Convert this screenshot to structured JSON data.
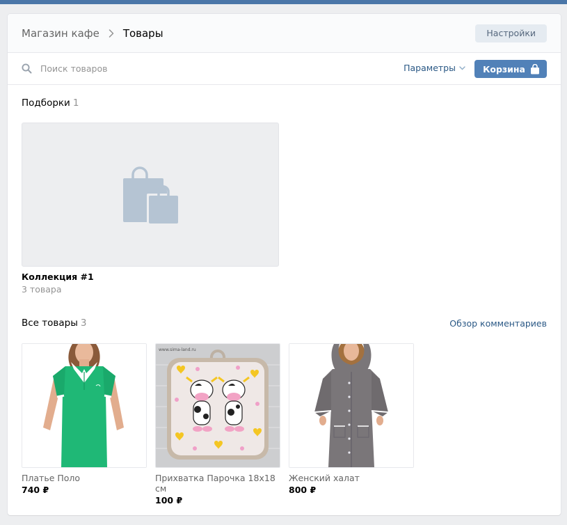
{
  "header": {
    "breadcrumb_parent": "Магазин кафе",
    "breadcrumb_current": "Товары",
    "settings_label": "Настройки"
  },
  "search": {
    "placeholder": "Поиск товаров",
    "params_label": "Параметры",
    "cart_label": "Корзина"
  },
  "collections": {
    "title": "Подборки",
    "count": "1",
    "items": [
      {
        "name": "Коллекция #1",
        "count_label": "3 товара"
      }
    ]
  },
  "all_goods": {
    "title": "Все товары",
    "count": "3",
    "comments_link": "Обзор комментариев",
    "items": [
      {
        "name": "Платье Поло",
        "price": "740 ₽"
      },
      {
        "name": "Прихватка Парочка 18х18 см",
        "price": "100 ₽"
      },
      {
        "name": "Женский халат",
        "price": "800 ₽"
      }
    ]
  },
  "watermark": "www.sima-land.ru",
  "colors": {
    "accent": "#5181b8",
    "topbar": "#4a76a8",
    "link": "#2a5885",
    "dress_green": "#1fb876",
    "robe_gray": "#7a7679"
  }
}
